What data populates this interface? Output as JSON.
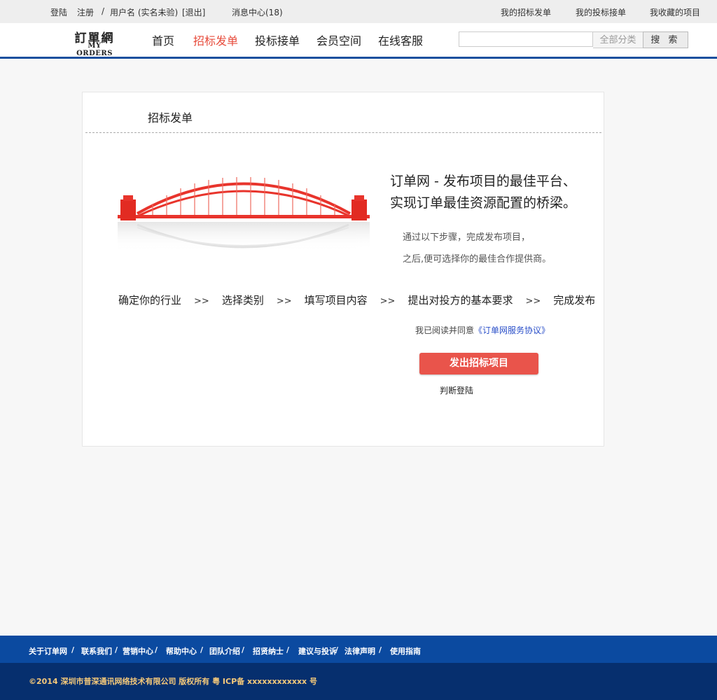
{
  "topbar": {
    "login": "登陆",
    "register": "注册",
    "separator": "/",
    "user": "用户名 (实名未验)",
    "logout": "[退出]",
    "messages": "消息中心(18)",
    "my_bids_posted": "我的招标发单",
    "my_bids_taken": "我的投标接单",
    "my_favorites": "我收藏的项目"
  },
  "header": {
    "logo_cn": "訂單網",
    "logo_en": "MY ORDERS",
    "nav": [
      "首页",
      "招标发单",
      "投标接单",
      "会员空间",
      "在线客服"
    ],
    "active_nav": "招标发单",
    "search_placeholder": "",
    "search_category": "全部分类",
    "search_button": "搜 索"
  },
  "card": {
    "title": "招标发单",
    "slogan_line1": "订单网 - 发布项目的最佳平台、",
    "slogan_line2": "实现订单最佳资源配置的桥梁。",
    "intro_line1": "通过以下步骤，完成发布项目，",
    "intro_line2": "之后,便可选择你的最佳合作提供商。",
    "steps": [
      "确定你的行业",
      "选择类别",
      "填写项目内容",
      "提出对投方的基本要求",
      "完成发布"
    ],
    "step_arrow": ">>",
    "agree_text": "我已阅读并同意",
    "agree_link": "《订单网服务协议》",
    "publish_button": "发出招标项目",
    "judge_login": "判断登陆"
  },
  "footer": {
    "links": [
      "关于订单网",
      "/",
      "联系我们",
      "/",
      "营销中心",
      "/",
      "帮助中心",
      "/",
      "团队介绍",
      "/",
      "招贤纳士",
      "/",
      "建议与投诉",
      "/",
      "法律声明",
      "/",
      "使用指南"
    ],
    "copyright": "©2014 深圳市普深通讯网络技术有限公司 版权所有 粤 ICP备 xxxxxxxxxxxx 号"
  },
  "colors": {
    "accent": "#e74c3c",
    "brand_blue": "#1a4f9e",
    "footer_top": "#0b4aa0",
    "footer_bottom": "#062f6e",
    "bridge_red": "#e8342c"
  }
}
